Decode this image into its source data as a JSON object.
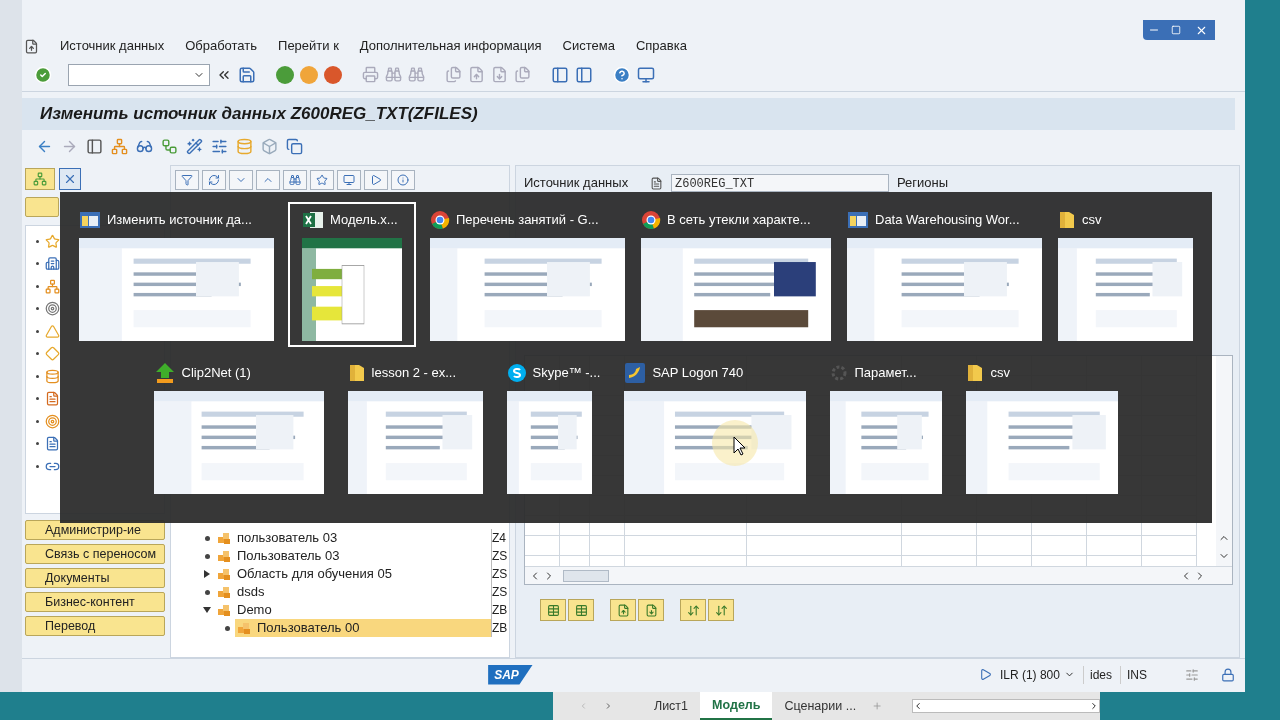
{
  "menu": [
    "Источник данных",
    "Обработать",
    "Перейти к",
    "Дополнительная информация",
    "Система",
    "Справка"
  ],
  "title": "Изменить источник данных Z600REG_TXT(ZFILES)",
  "header_field": {
    "label": "Источник данных",
    "value": "Z600REG_TXT",
    "description": "Регионы"
  },
  "nav_buttons": [
    "Администрир-ие",
    "Связь с переносом",
    "Документы",
    "Бизнес-контент",
    "Перевод"
  ],
  "tree": [
    {
      "label": "пользователь 03",
      "code": "Z4",
      "kind": "leaf",
      "selected": false
    },
    {
      "label": "Пользователь 03",
      "code": "ZS",
      "kind": "leaf",
      "selected": false
    },
    {
      "label": "Область для обучения 05",
      "code": "ZS",
      "kind": "folder",
      "expanded": false,
      "selected": false
    },
    {
      "label": "dsds",
      "code": "ZS",
      "kind": "leaf",
      "selected": false
    },
    {
      "label": "Demo",
      "code": "ZB",
      "kind": "folder",
      "expanded": true,
      "selected": false,
      "children": [
        {
          "label": "Пользователь 00",
          "code": "ZB",
          "kind": "leaf",
          "selected": true
        }
      ]
    }
  ],
  "switcher": {
    "windows": [
      {
        "title": "Изменить источник да...",
        "kind": "sap",
        "selected": false
      },
      {
        "title": "Модель.x...",
        "kind": "excel",
        "selected": true
      },
      {
        "title": "Перечень занятий - G...",
        "kind": "chrome",
        "selected": false
      },
      {
        "title": "В сеть утекли характе...",
        "kind": "chrome",
        "selected": false
      },
      {
        "title": "Data Warehousing Wor...",
        "kind": "sap",
        "selected": false
      },
      {
        "title": "csv",
        "kind": "folder",
        "selected": false
      },
      {
        "title": "Clip2Net (1)",
        "kind": "upload",
        "selected": false
      },
      {
        "title": "lesson 2 - ex...",
        "kind": "folder",
        "selected": false
      },
      {
        "title": "Skype™ -...",
        "kind": "skype",
        "selected": false
      },
      {
        "title": "SAP Logon 740",
        "kind": "logon",
        "selected": false
      },
      {
        "title": "Парамет...",
        "kind": "settings",
        "selected": false
      },
      {
        "title": "csv",
        "kind": "folder",
        "selected": false
      }
    ]
  },
  "status_bar": {
    "logo": "SAP",
    "system": "ILR (1) 800",
    "client": "ides",
    "mode": "INS"
  },
  "sheet_tabs": [
    {
      "label": "Лист1",
      "selected": false
    },
    {
      "label": "Модель",
      "selected": true
    },
    {
      "label": "Сценарии ...",
      "selected": false
    }
  ]
}
